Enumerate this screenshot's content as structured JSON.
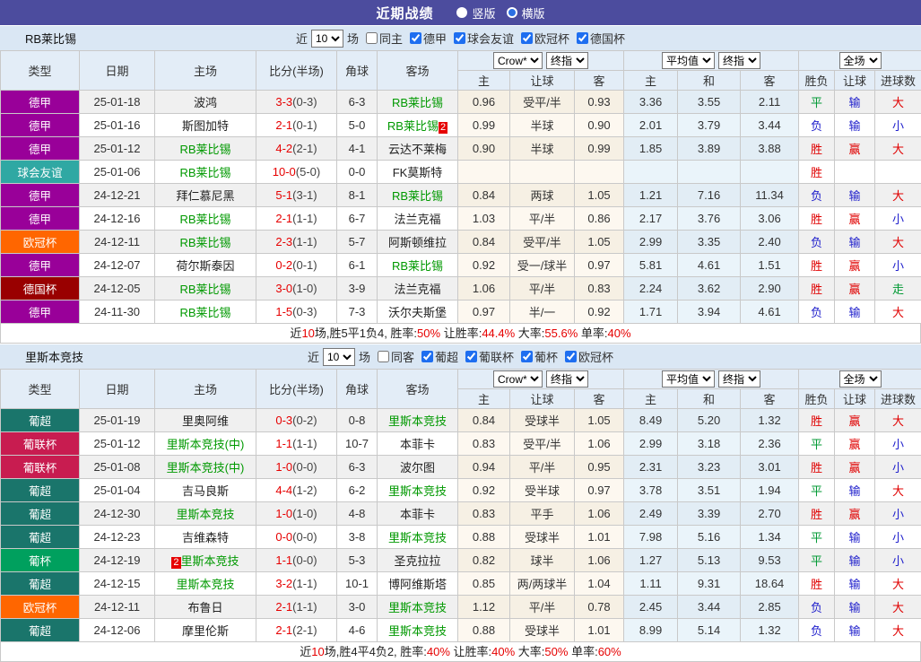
{
  "topbar": {
    "title": "近期战绩",
    "radios": [
      {
        "label": "竖版",
        "checked": false
      },
      {
        "label": "横版",
        "checked": true
      }
    ]
  },
  "league_colors": {
    "德甲": "#990099",
    "球会友谊": "#2FA8A3",
    "欧冠杯": "#FF6600",
    "德国杯": "#990000",
    "葡超": "#1A756B",
    "葡联杯": "#C81C50",
    "葡杯": "#00A05E"
  },
  "outcome_colors": {
    "胜": "#E00000",
    "平": "#009933",
    "负": "#2020CC",
    "赢": "#E00000",
    "输": "#2020CC",
    "走": "#009933",
    "大": "#E00000",
    "小": "#2020CC"
  },
  "table_header": {
    "cols": [
      "类型",
      "日期",
      "主场",
      "比分(半场)",
      "角球",
      "客场"
    ],
    "selects": {
      "crow": "Crow*",
      "final1": "终指",
      "avg": "平均值",
      "final2": "终指",
      "scope": "全场"
    },
    "sub": [
      "主",
      "让球",
      "客",
      "主",
      "和",
      "客",
      "胜负",
      "让球",
      "进球数"
    ]
  },
  "sections": [
    {
      "team": "RB莱比锡",
      "filter": {
        "near_label": "近",
        "select_value": "10",
        "games_label": "场",
        "same": {
          "label": "同主",
          "checked": false
        },
        "leagues": [
          {
            "label": "德甲",
            "checked": true
          },
          {
            "label": "球会友谊",
            "checked": true
          },
          {
            "label": "欧冠杯",
            "checked": true
          },
          {
            "label": "德国杯",
            "checked": true
          }
        ]
      },
      "rows": [
        {
          "league": "德甲",
          "date": "25-01-18",
          "home": "波鸿",
          "home_is_team": false,
          "score": "3-3",
          "half": "(0-3)",
          "corner": "6-3",
          "away": "RB莱比锡",
          "away_is_team": true,
          "odds": [
            "0.96",
            "受平/半",
            "0.93",
            "3.36",
            "3.55",
            "2.11"
          ],
          "results": [
            "平",
            "输",
            "大"
          ]
        },
        {
          "league": "德甲",
          "date": "25-01-16",
          "home": "斯图加特",
          "home_is_team": false,
          "score": "2-1",
          "half": "(0-1)",
          "corner": "5-0",
          "away": "RB莱比锡",
          "away_is_team": true,
          "away_badge": {
            "text": "2",
            "pos": "after"
          },
          "odds": [
            "0.99",
            "半球",
            "0.90",
            "2.01",
            "3.79",
            "3.44"
          ],
          "results": [
            "负",
            "输",
            "小"
          ]
        },
        {
          "league": "德甲",
          "date": "25-01-12",
          "home": "RB莱比锡",
          "home_is_team": true,
          "score": "4-2",
          "half": "(2-1)",
          "corner": "4-1",
          "away": "云达不莱梅",
          "away_is_team": false,
          "odds": [
            "0.90",
            "半球",
            "0.99",
            "1.85",
            "3.89",
            "3.88"
          ],
          "results": [
            "胜",
            "赢",
            "大"
          ]
        },
        {
          "league": "球会友谊",
          "date": "25-01-06",
          "home": "RB莱比锡",
          "home_is_team": true,
          "score": "10-0",
          "half": "(5-0)",
          "corner": "0-0",
          "away": "FK莫斯特",
          "away_is_team": false,
          "odds": [
            "",
            "",
            "",
            "",
            "",
            ""
          ],
          "results": [
            "胜",
            "",
            ""
          ]
        },
        {
          "league": "德甲",
          "date": "24-12-21",
          "home": "拜仁慕尼黑",
          "home_is_team": false,
          "score": "5-1",
          "half": "(3-1)",
          "corner": "8-1",
          "away": "RB莱比锡",
          "away_is_team": true,
          "odds": [
            "0.84",
            "两球",
            "1.05",
            "1.21",
            "7.16",
            "11.34"
          ],
          "results": [
            "负",
            "输",
            "大"
          ]
        },
        {
          "league": "德甲",
          "date": "24-12-16",
          "home": "RB莱比锡",
          "home_is_team": true,
          "score": "2-1",
          "half": "(1-1)",
          "corner": "6-7",
          "away": "法兰克福",
          "away_is_team": false,
          "odds": [
            "1.03",
            "平/半",
            "0.86",
            "2.17",
            "3.76",
            "3.06"
          ],
          "results": [
            "胜",
            "赢",
            "小"
          ]
        },
        {
          "league": "欧冠杯",
          "date": "24-12-11",
          "home": "RB莱比锡",
          "home_is_team": true,
          "score": "2-3",
          "half": "(1-1)",
          "corner": "5-7",
          "away": "阿斯顿维拉",
          "away_is_team": false,
          "odds": [
            "0.84",
            "受平/半",
            "1.05",
            "2.99",
            "3.35",
            "2.40"
          ],
          "results": [
            "负",
            "输",
            "大"
          ]
        },
        {
          "league": "德甲",
          "date": "24-12-07",
          "home": "荷尔斯泰因",
          "home_is_team": false,
          "score": "0-2",
          "half": "(0-1)",
          "corner": "6-1",
          "away": "RB莱比锡",
          "away_is_team": true,
          "odds": [
            "0.92",
            "受一/球半",
            "0.97",
            "5.81",
            "4.61",
            "1.51"
          ],
          "results": [
            "胜",
            "赢",
            "小"
          ]
        },
        {
          "league": "德国杯",
          "date": "24-12-05",
          "home": "RB莱比锡",
          "home_is_team": true,
          "score": "3-0",
          "half": "(1-0)",
          "corner": "3-9",
          "away": "法兰克福",
          "away_is_team": false,
          "odds": [
            "1.06",
            "平/半",
            "0.83",
            "2.24",
            "3.62",
            "2.90"
          ],
          "results": [
            "胜",
            "赢",
            "走"
          ]
        },
        {
          "league": "德甲",
          "date": "24-11-30",
          "home": "RB莱比锡",
          "home_is_team": true,
          "score": "1-5",
          "half": "(0-3)",
          "corner": "7-3",
          "away": "沃尔夫斯堡",
          "away_is_team": false,
          "odds": [
            "0.97",
            "半/一",
            "0.92",
            "1.71",
            "3.94",
            "4.61"
          ],
          "results": [
            "负",
            "输",
            "大"
          ]
        }
      ],
      "summary": [
        {
          "text": "近",
          "red": false
        },
        {
          "text": "10",
          "red": true
        },
        {
          "text": "场,胜5平1负4, 胜率:",
          "red": false
        },
        {
          "text": "50%",
          "red": true
        },
        {
          "text": " 让胜率:",
          "red": false
        },
        {
          "text": "44.4%",
          "red": true
        },
        {
          "text": " 大率:",
          "red": false
        },
        {
          "text": "55.6%",
          "red": true
        },
        {
          "text": " 单率:",
          "red": false
        },
        {
          "text": "40%",
          "red": true
        }
      ]
    },
    {
      "team": "里斯本竞技",
      "filter": {
        "near_label": "近",
        "select_value": "10",
        "games_label": "场",
        "same": {
          "label": "同客",
          "checked": false
        },
        "leagues": [
          {
            "label": "葡超",
            "checked": true
          },
          {
            "label": "葡联杯",
            "checked": true
          },
          {
            "label": "葡杯",
            "checked": true
          },
          {
            "label": "欧冠杯",
            "checked": true
          }
        ]
      },
      "rows": [
        {
          "league": "葡超",
          "date": "25-01-19",
          "home": "里奥阿维",
          "home_is_team": false,
          "score": "0-3",
          "half": "(0-2)",
          "corner": "0-8",
          "away": "里斯本竞技",
          "away_is_team": true,
          "odds": [
            "0.84",
            "受球半",
            "1.05",
            "8.49",
            "5.20",
            "1.32"
          ],
          "results": [
            "胜",
            "赢",
            "大"
          ]
        },
        {
          "league": "葡联杯",
          "date": "25-01-12",
          "home": "里斯本竞技(中)",
          "home_is_team": true,
          "score": "1-1",
          "half": "(1-1)",
          "corner": "10-7",
          "away": "本菲卡",
          "away_is_team": false,
          "odds": [
            "0.83",
            "受平/半",
            "1.06",
            "2.99",
            "3.18",
            "2.36"
          ],
          "results": [
            "平",
            "赢",
            "小"
          ]
        },
        {
          "league": "葡联杯",
          "date": "25-01-08",
          "home": "里斯本竞技(中)",
          "home_is_team": true,
          "score": "1-0",
          "half": "(0-0)",
          "corner": "6-3",
          "away": "波尔图",
          "away_is_team": false,
          "odds": [
            "0.94",
            "平/半",
            "0.95",
            "2.31",
            "3.23",
            "3.01"
          ],
          "results": [
            "胜",
            "赢",
            "小"
          ]
        },
        {
          "league": "葡超",
          "date": "25-01-04",
          "home": "吉马良斯",
          "home_is_team": false,
          "score": "4-4",
          "half": "(1-2)",
          "corner": "6-2",
          "away": "里斯本竞技",
          "away_is_team": true,
          "odds": [
            "0.92",
            "受半球",
            "0.97",
            "3.78",
            "3.51",
            "1.94"
          ],
          "results": [
            "平",
            "输",
            "大"
          ]
        },
        {
          "league": "葡超",
          "date": "24-12-30",
          "home": "里斯本竞技",
          "home_is_team": true,
          "score": "1-0",
          "half": "(1-0)",
          "corner": "4-8",
          "away": "本菲卡",
          "away_is_team": false,
          "odds": [
            "0.83",
            "平手",
            "1.06",
            "2.49",
            "3.39",
            "2.70"
          ],
          "results": [
            "胜",
            "赢",
            "小"
          ]
        },
        {
          "league": "葡超",
          "date": "24-12-23",
          "home": "吉维森特",
          "home_is_team": false,
          "score": "0-0",
          "half": "(0-0)",
          "corner": "3-8",
          "away": "里斯本竞技",
          "away_is_team": true,
          "odds": [
            "0.88",
            "受球半",
            "1.01",
            "7.98",
            "5.16",
            "1.34"
          ],
          "results": [
            "平",
            "输",
            "小"
          ]
        },
        {
          "league": "葡杯",
          "date": "24-12-19",
          "home": "里斯本竞技",
          "home_is_team": true,
          "home_badge": {
            "text": "2",
            "pos": "before"
          },
          "score": "1-1",
          "half": "(0-0)",
          "corner": "5-3",
          "away": "圣克拉拉",
          "away_is_team": false,
          "odds": [
            "0.82",
            "球半",
            "1.06",
            "1.27",
            "5.13",
            "9.53"
          ],
          "results": [
            "平",
            "输",
            "小"
          ]
        },
        {
          "league": "葡超",
          "date": "24-12-15",
          "home": "里斯本竞技",
          "home_is_team": true,
          "score": "3-2",
          "half": "(1-1)",
          "corner": "10-1",
          "away": "博阿维斯塔",
          "away_is_team": false,
          "odds": [
            "0.85",
            "两/两球半",
            "1.04",
            "1.11",
            "9.31",
            "18.64"
          ],
          "results": [
            "胜",
            "输",
            "大"
          ]
        },
        {
          "league": "欧冠杯",
          "date": "24-12-11",
          "home": "布鲁日",
          "home_is_team": false,
          "score": "2-1",
          "half": "(1-1)",
          "corner": "3-0",
          "away": "里斯本竞技",
          "away_is_team": true,
          "odds": [
            "1.12",
            "平/半",
            "0.78",
            "2.45",
            "3.44",
            "2.85"
          ],
          "results": [
            "负",
            "输",
            "大"
          ]
        },
        {
          "league": "葡超",
          "date": "24-12-06",
          "home": "摩里伦斯",
          "home_is_team": false,
          "score": "2-1",
          "half": "(2-1)",
          "corner": "4-6",
          "away": "里斯本竞技",
          "away_is_team": true,
          "odds": [
            "0.88",
            "受球半",
            "1.01",
            "8.99",
            "5.14",
            "1.32"
          ],
          "results": [
            "负",
            "输",
            "大"
          ]
        }
      ],
      "summary": [
        {
          "text": "近",
          "red": false
        },
        {
          "text": "10",
          "red": true
        },
        {
          "text": "场,胜4平4负2, 胜率:",
          "red": false
        },
        {
          "text": "40%",
          "red": true
        },
        {
          "text": " 让胜率:",
          "red": false
        },
        {
          "text": "40%",
          "red": true
        },
        {
          "text": " 大率:",
          "red": false
        },
        {
          "text": "50%",
          "red": true
        },
        {
          "text": " 单率:",
          "red": false
        },
        {
          "text": "60%",
          "red": true
        }
      ]
    }
  ]
}
